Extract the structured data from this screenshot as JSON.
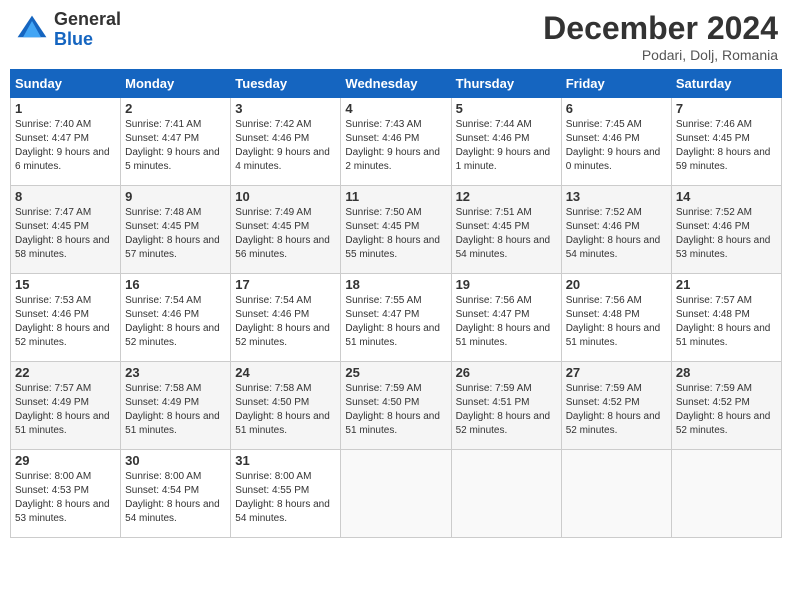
{
  "header": {
    "logo_general": "General",
    "logo_blue": "Blue",
    "month_title": "December 2024",
    "location": "Podari, Dolj, Romania"
  },
  "weekdays": [
    "Sunday",
    "Monday",
    "Tuesday",
    "Wednesday",
    "Thursday",
    "Friday",
    "Saturday"
  ],
  "weeks": [
    [
      {
        "day": "1",
        "sunrise": "7:40 AM",
        "sunset": "4:47 PM",
        "daylight": "9 hours and 6 minutes."
      },
      {
        "day": "2",
        "sunrise": "7:41 AM",
        "sunset": "4:47 PM",
        "daylight": "9 hours and 5 minutes."
      },
      {
        "day": "3",
        "sunrise": "7:42 AM",
        "sunset": "4:46 PM",
        "daylight": "9 hours and 4 minutes."
      },
      {
        "day": "4",
        "sunrise": "7:43 AM",
        "sunset": "4:46 PM",
        "daylight": "9 hours and 2 minutes."
      },
      {
        "day": "5",
        "sunrise": "7:44 AM",
        "sunset": "4:46 PM",
        "daylight": "9 hours and 1 minute."
      },
      {
        "day": "6",
        "sunrise": "7:45 AM",
        "sunset": "4:46 PM",
        "daylight": "9 hours and 0 minutes."
      },
      {
        "day": "7",
        "sunrise": "7:46 AM",
        "sunset": "4:45 PM",
        "daylight": "8 hours and 59 minutes."
      }
    ],
    [
      {
        "day": "8",
        "sunrise": "7:47 AM",
        "sunset": "4:45 PM",
        "daylight": "8 hours and 58 minutes."
      },
      {
        "day": "9",
        "sunrise": "7:48 AM",
        "sunset": "4:45 PM",
        "daylight": "8 hours and 57 minutes."
      },
      {
        "day": "10",
        "sunrise": "7:49 AM",
        "sunset": "4:45 PM",
        "daylight": "8 hours and 56 minutes."
      },
      {
        "day": "11",
        "sunrise": "7:50 AM",
        "sunset": "4:45 PM",
        "daylight": "8 hours and 55 minutes."
      },
      {
        "day": "12",
        "sunrise": "7:51 AM",
        "sunset": "4:45 PM",
        "daylight": "8 hours and 54 minutes."
      },
      {
        "day": "13",
        "sunrise": "7:52 AM",
        "sunset": "4:46 PM",
        "daylight": "8 hours and 54 minutes."
      },
      {
        "day": "14",
        "sunrise": "7:52 AM",
        "sunset": "4:46 PM",
        "daylight": "8 hours and 53 minutes."
      }
    ],
    [
      {
        "day": "15",
        "sunrise": "7:53 AM",
        "sunset": "4:46 PM",
        "daylight": "8 hours and 52 minutes."
      },
      {
        "day": "16",
        "sunrise": "7:54 AM",
        "sunset": "4:46 PM",
        "daylight": "8 hours and 52 minutes."
      },
      {
        "day": "17",
        "sunrise": "7:54 AM",
        "sunset": "4:46 PM",
        "daylight": "8 hours and 52 minutes."
      },
      {
        "day": "18",
        "sunrise": "7:55 AM",
        "sunset": "4:47 PM",
        "daylight": "8 hours and 51 minutes."
      },
      {
        "day": "19",
        "sunrise": "7:56 AM",
        "sunset": "4:47 PM",
        "daylight": "8 hours and 51 minutes."
      },
      {
        "day": "20",
        "sunrise": "7:56 AM",
        "sunset": "4:48 PM",
        "daylight": "8 hours and 51 minutes."
      },
      {
        "day": "21",
        "sunrise": "7:57 AM",
        "sunset": "4:48 PM",
        "daylight": "8 hours and 51 minutes."
      }
    ],
    [
      {
        "day": "22",
        "sunrise": "7:57 AM",
        "sunset": "4:49 PM",
        "daylight": "8 hours and 51 minutes."
      },
      {
        "day": "23",
        "sunrise": "7:58 AM",
        "sunset": "4:49 PM",
        "daylight": "8 hours and 51 minutes."
      },
      {
        "day": "24",
        "sunrise": "7:58 AM",
        "sunset": "4:50 PM",
        "daylight": "8 hours and 51 minutes."
      },
      {
        "day": "25",
        "sunrise": "7:59 AM",
        "sunset": "4:50 PM",
        "daylight": "8 hours and 51 minutes."
      },
      {
        "day": "26",
        "sunrise": "7:59 AM",
        "sunset": "4:51 PM",
        "daylight": "8 hours and 52 minutes."
      },
      {
        "day": "27",
        "sunrise": "7:59 AM",
        "sunset": "4:52 PM",
        "daylight": "8 hours and 52 minutes."
      },
      {
        "day": "28",
        "sunrise": "7:59 AM",
        "sunset": "4:52 PM",
        "daylight": "8 hours and 52 minutes."
      }
    ],
    [
      {
        "day": "29",
        "sunrise": "8:00 AM",
        "sunset": "4:53 PM",
        "daylight": "8 hours and 53 minutes."
      },
      {
        "day": "30",
        "sunrise": "8:00 AM",
        "sunset": "4:54 PM",
        "daylight": "8 hours and 54 minutes."
      },
      {
        "day": "31",
        "sunrise": "8:00 AM",
        "sunset": "4:55 PM",
        "daylight": "8 hours and 54 minutes."
      },
      null,
      null,
      null,
      null
    ]
  ]
}
